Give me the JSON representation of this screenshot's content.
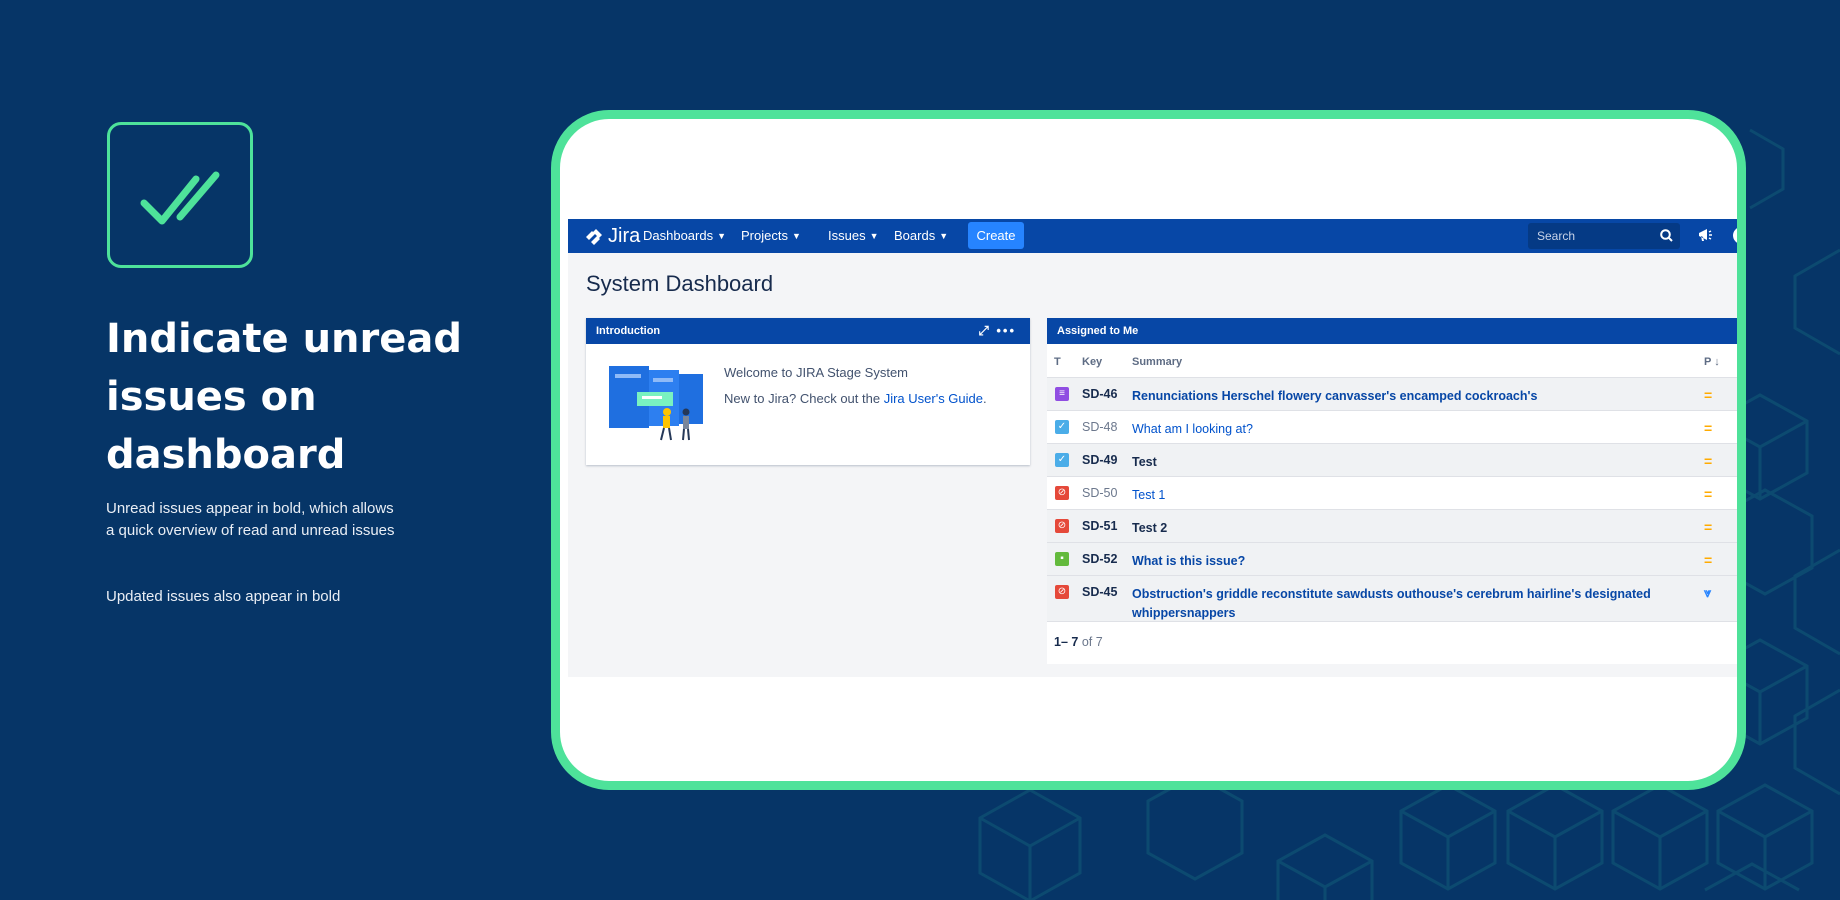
{
  "left": {
    "title": "Indicate unread issues on dashboard",
    "description1": "Unread issues appear in bold, which allows a quick overview of read and unread issues",
    "description2": "Updated issues also appear in bold"
  },
  "colors": {
    "background": "#063567",
    "accent": "#4ee29a",
    "jira_nav": "#0747a6",
    "create_button": "#2684ff",
    "link": "#0052cc",
    "priority_medium": "#ffab00",
    "priority_lowest": "#2684ff"
  },
  "jira": {
    "logo_text": "Jira",
    "nav": {
      "dashboards": "Dashboards",
      "projects": "Projects",
      "issues": "Issues",
      "boards": "Boards",
      "create": "Create",
      "search_placeholder": "Search",
      "help": "?"
    },
    "page_title": "System Dashboard",
    "intro_gadget": {
      "title": "Introduction",
      "welcome": "Welcome to JIRA Stage System",
      "new_to_prefix": "New to Jira? Check out the ",
      "guide_link": "Jira User's Guide",
      "new_to_suffix": "."
    },
    "assigned_gadget": {
      "title": "Assigned to Me",
      "columns": {
        "type": "T",
        "key": "Key",
        "summary": "Summary",
        "priority": "P"
      },
      "rows": [
        {
          "type": "story",
          "key": "SD-46",
          "summary": "Renunciations Herschel flowery canvasser's encamped cockroach's",
          "bold": true,
          "priority": "medium"
        },
        {
          "type": "task",
          "key": "SD-48",
          "summary": "What am I looking at?",
          "bold": false,
          "priority": "medium"
        },
        {
          "type": "task",
          "key": "SD-49",
          "summary": "Test",
          "bold": true,
          "priority": "medium"
        },
        {
          "type": "bug",
          "key": "SD-50",
          "summary": "Test 1",
          "bold": false,
          "priority": "medium"
        },
        {
          "type": "bug",
          "key": "SD-51",
          "summary": "Test 2",
          "bold": true,
          "priority": "medium"
        },
        {
          "type": "improvement",
          "key": "SD-52",
          "summary": "What is this issue?",
          "bold": true,
          "priority": "medium"
        },
        {
          "type": "bug",
          "key": "SD-45",
          "summary": "Obstruction's griddle reconstitute sawdusts outhouse's cerebrum hairline's designated whippersnappers",
          "bold": true,
          "priority": "lowest"
        }
      ],
      "paging": {
        "range": "1– 7",
        "of": "of 7"
      }
    }
  }
}
